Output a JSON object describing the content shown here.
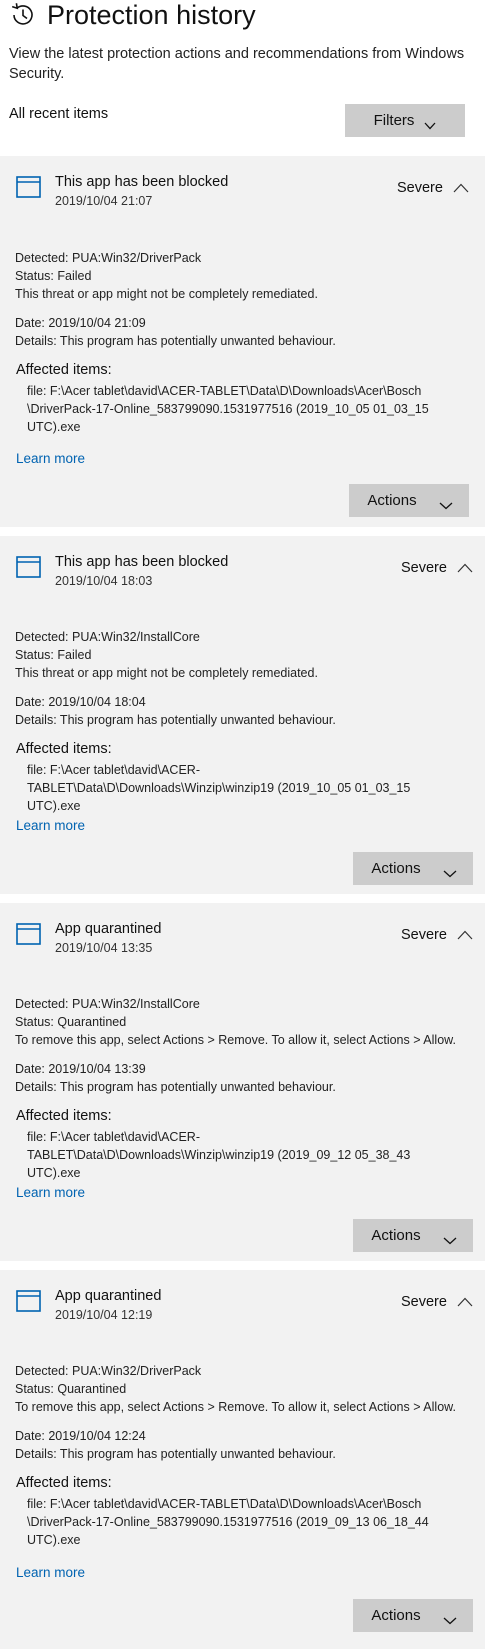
{
  "header": {
    "title": "Protection history",
    "description": "View the latest protection actions and recommendations from Windows Security.",
    "all_recent_label": "All recent items",
    "filters_label": "Filters"
  },
  "icons": {
    "history": "history-icon",
    "app_window": "app-window-icon",
    "chevron_up": "chevron-up-icon",
    "chevron_down": "chevron-down-icon"
  },
  "colors": {
    "card_background": "#f2f2f2",
    "button_background": "#cccccc",
    "link": "#0063b1"
  },
  "cards": [
    {
      "title": "This app has been blocked",
      "time": "2019/10/04 21:07",
      "severity": "Severe",
      "detected": "Detected:  PUA:Win32/DriverPack",
      "status": "Status:  Failed",
      "note": "This threat or app might not be completely remediated.",
      "date": "Date:  2019/10/04 21:09",
      "details": "Details:  This program has potentially unwanted behaviour.",
      "affected_title": "Affected items:",
      "affected_file": "file: F:\\Acer tablet\\david\\ACER-TABLET\\Data\\D\\Downloads\\Acer\\Bosch \\DriverPack-17-Online_583799090.1531977516 (2019_10_05 01_03_15 UTC).exe",
      "learn_more": "Learn more",
      "actions_label": "Actions"
    },
    {
      "title": "This app has been blocked",
      "time": "2019/10/04 18:03",
      "severity": "Severe",
      "detected": "Detected:  PUA:Win32/InstallCore",
      "status": "Status:  Failed",
      "note": "This threat or app might not be completely remediated.",
      "date": "Date:  2019/10/04 18:04",
      "details": "Details:  This program has potentially unwanted behaviour.",
      "affected_title": "Affected items:",
      "affected_file": "file: F:\\Acer tablet\\david\\ACER-TABLET\\Data\\D\\Downloads\\Winzip\\winzip19 (2019_10_05 01_03_15 UTC).exe",
      "learn_more": "Learn more",
      "actions_label": "Actions"
    },
    {
      "title": "App quarantined",
      "time": "2019/10/04 13:35",
      "severity": "Severe",
      "detected": "Detected:  PUA:Win32/InstallCore",
      "status": "Status:  Quarantined",
      "note": "To remove this app, select Actions > Remove. To allow it, select Actions > Allow.",
      "date": "Date:  2019/10/04 13:39",
      "details": "Details:  This program has potentially unwanted behaviour.",
      "affected_title": "Affected items:",
      "affected_file": "file: F:\\Acer tablet\\david\\ACER-TABLET\\Data\\D\\Downloads\\Winzip\\winzip19 (2019_09_12 05_38_43 UTC).exe",
      "learn_more": "Learn more",
      "actions_label": "Actions"
    },
    {
      "title": "App quarantined",
      "time": "2019/10/04 12:19",
      "severity": "Severe",
      "detected": "Detected:  PUA:Win32/DriverPack",
      "status": "Status:  Quarantined",
      "note": "To remove this app, select Actions > Remove. To allow it, select Actions > Allow.",
      "date": "Date:  2019/10/04 12:24",
      "details": "Details:  This program has potentially unwanted behaviour.",
      "affected_title": "Affected items:",
      "affected_file": "file: F:\\Acer tablet\\david\\ACER-TABLET\\Data\\D\\Downloads\\Acer\\Bosch \\DriverPack-17-Online_583799090.1531977516 (2019_09_13 06_18_44 UTC).exe",
      "learn_more": "Learn more",
      "actions_label": "Actions"
    }
  ]
}
